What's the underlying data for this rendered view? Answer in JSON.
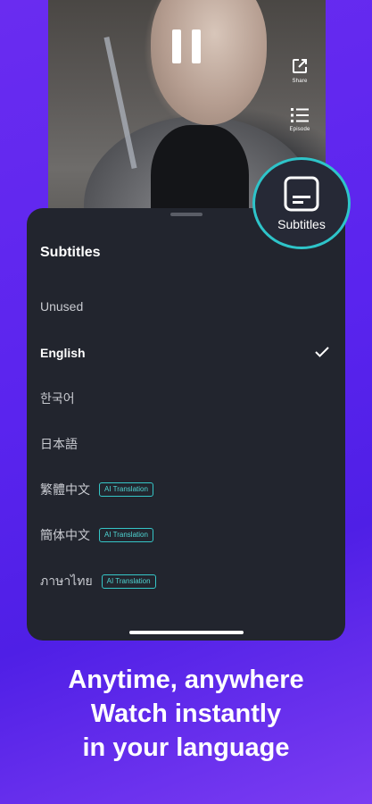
{
  "video": {
    "pause_icon": "pause-icon",
    "share": {
      "label": "Share",
      "icon": "share-icon"
    },
    "episode": {
      "label": "Episode",
      "icon": "list-icon"
    }
  },
  "subtitles_button": {
    "label": "Subtitles",
    "icon": "subtitles-icon",
    "ring_color": "#2ec4c9"
  },
  "sheet": {
    "title": "Subtitles",
    "options": [
      {
        "label": "Unused",
        "selected": false,
        "badge": ""
      },
      {
        "label": "English",
        "selected": true,
        "badge": ""
      },
      {
        "label": "한국어",
        "selected": false,
        "badge": ""
      },
      {
        "label": "日本語",
        "selected": false,
        "badge": ""
      },
      {
        "label": "繁體中文",
        "selected": false,
        "badge": "AI Translation"
      },
      {
        "label": "簡体中文",
        "selected": false,
        "badge": "AI Translation"
      },
      {
        "label": "ภาษาไทย",
        "selected": false,
        "badge": "AI Translation"
      }
    ],
    "check_icon": "checkmark-icon",
    "badge_color": "#35c6c7"
  },
  "promo": {
    "line1": "Anytime, anywhere",
    "line2": "Watch instantly",
    "line3": "in your language"
  },
  "colors": {
    "background": "#5a24ee",
    "sheet": "#22252e"
  }
}
